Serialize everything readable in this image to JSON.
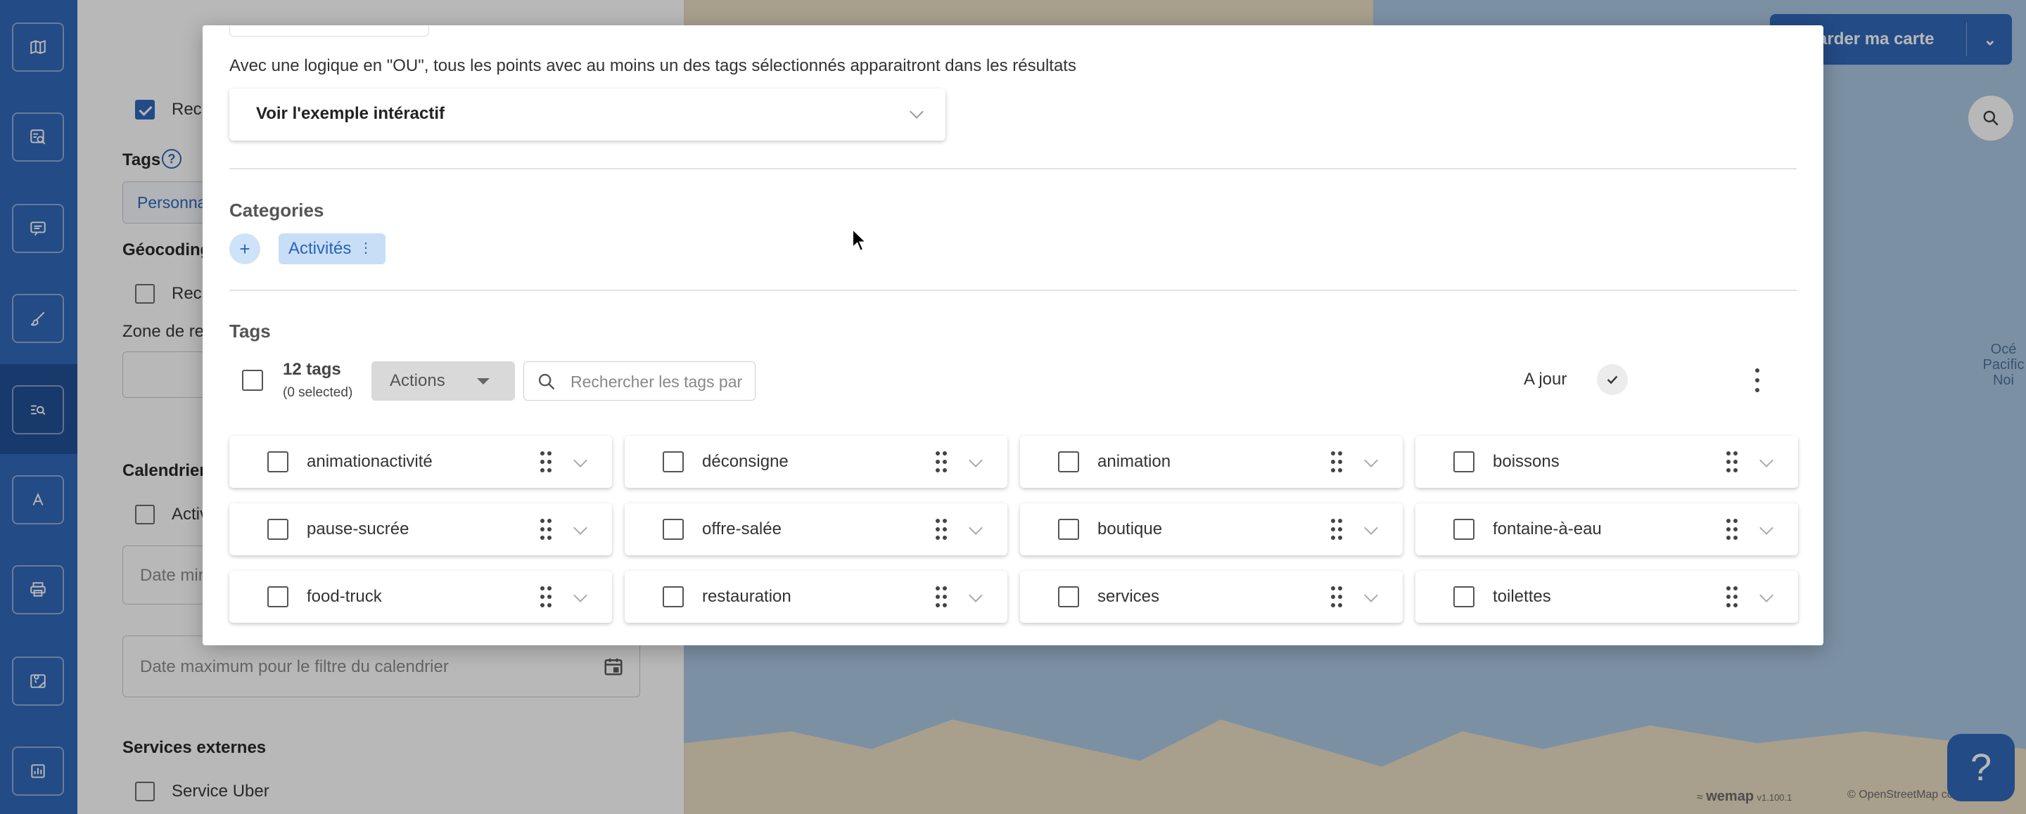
{
  "rail": {
    "items": [
      {
        "icon": "map-icon"
      },
      {
        "icon": "map-search-icon"
      },
      {
        "icon": "message-icon"
      },
      {
        "icon": "brush-icon"
      },
      {
        "icon": "search-list-icon"
      },
      {
        "icon": "text-icon"
      },
      {
        "icon": "print-icon"
      },
      {
        "icon": "map-pin-icon"
      },
      {
        "icon": "dashboard-icon"
      }
    ]
  },
  "panel": {
    "search_checkbox_label": "Rech",
    "tags_heading": "Tags",
    "tags_field_text": "Personna",
    "geocoding_heading": "Géocoding",
    "geocoding_checkbox_label": "Rech",
    "zone_label": "Zone de rec",
    "calendar_heading": "Calendrier",
    "calendar_checkbox_label": "Activ",
    "date_min_placeholder": "Date min",
    "date_max_placeholder": "Date maximum pour le filtre du calendrier",
    "external_heading": "Services externes",
    "uber_label": "Service Uber"
  },
  "map": {
    "export_label": "egarder ma carte",
    "ocean_label": [
      "Océ",
      "Pacific",
      "Noi"
    ],
    "brand": "wemap",
    "version": "v1.100.1",
    "copyright": "© OpenStreetMap co"
  },
  "modal": {
    "description": "Avec une logique en \"OU\", tous les points avec au moins un des tags sélectionnés apparaitront dans les résultats",
    "example_title": "Voir l'exemple intéractif",
    "categories_heading": "Categories",
    "add_symbol": "+",
    "category_chip": "Activités",
    "tags_heading": "Tags",
    "tag_count": "12 tags",
    "selected_count": "(0 selected)",
    "actions_label": "Actions",
    "search_placeholder": "Rechercher les tags par",
    "status_label": "A jour",
    "tags": [
      [
        "animationactivité",
        "déconsigne",
        "animation",
        "boissons"
      ],
      [
        "pause-sucrée",
        "offre-salée",
        "boutique",
        "fontaine-à-eau"
      ],
      [
        "food-truck",
        "restauration",
        "services",
        "toilettes"
      ]
    ]
  },
  "colors": {
    "primary": "#2a63b8",
    "chip_bg": "#c8def6",
    "map_water": "#a9c6e2",
    "map_land": "#e9dcc1"
  }
}
